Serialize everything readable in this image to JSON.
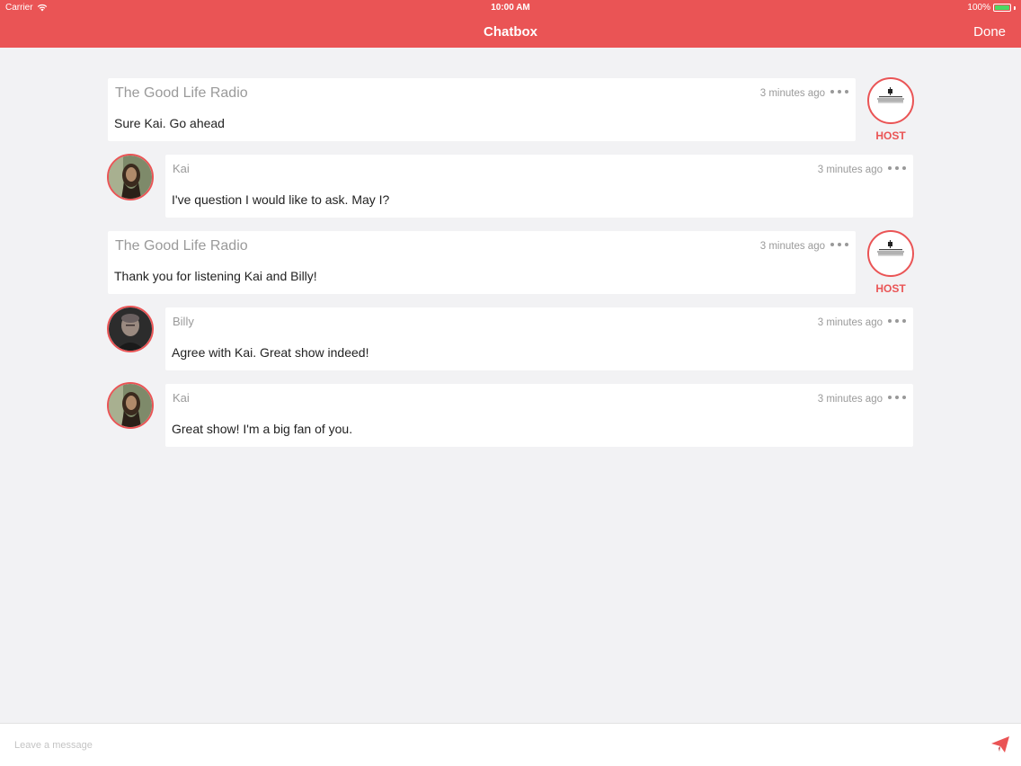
{
  "status_bar": {
    "carrier": "Carrier",
    "time": "10:00 AM",
    "battery": "100%",
    "battery_level": 1.0,
    "battery_color": "#4cd964"
  },
  "nav": {
    "title": "Chatbox",
    "done_label": "Done",
    "bar_color": "#ea5455"
  },
  "host_badge": "HOST",
  "messages": [
    {
      "role": "host",
      "name": "The Good Life Radio",
      "time": "3 minutes ago",
      "text": "Sure Kai. Go ahead",
      "avatar_icon": "radio-logo-icon"
    },
    {
      "role": "user",
      "name": "Kai",
      "time": "3 minutes ago",
      "text": "I've question I would like to ask. May I?",
      "avatar_icon": "user-photo-kai"
    },
    {
      "role": "host",
      "name": "The Good Life Radio",
      "time": "3 minutes ago",
      "text": "Thank you for listening Kai and Billy!",
      "avatar_icon": "radio-logo-icon"
    },
    {
      "role": "user",
      "name": "Billy",
      "time": "3 minutes ago",
      "text": "Agree with Kai. Great show indeed!",
      "avatar_icon": "user-photo-billy"
    },
    {
      "role": "user",
      "name": "Kai",
      "time": "3 minutes ago",
      "text": "Great show! I'm a big fan of you.",
      "avatar_icon": "user-photo-kai"
    }
  ],
  "composer": {
    "placeholder": "Leave a message",
    "value": "",
    "send_icon": "paper-plane-icon"
  }
}
